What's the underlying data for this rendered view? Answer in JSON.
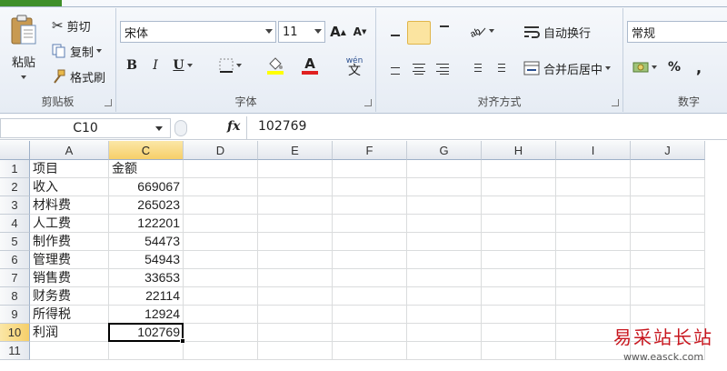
{
  "ribbon": {
    "clipboard": {
      "paste_label": "粘贴",
      "cut_label": "剪切",
      "copy_label": "复制",
      "format_painter_label": "格式刷",
      "group_label": "剪贴板"
    },
    "font": {
      "font_name": "宋体",
      "font_size": "11",
      "grow_label": "A",
      "shrink_label": "A",
      "bold_label": "B",
      "italic_label": "I",
      "underline_label": "U",
      "font_color_label": "A",
      "phonetic_label": "wén",
      "phonetic_char": "文",
      "group_label": "字体"
    },
    "alignment": {
      "wrap_text_label": "自动换行",
      "merge_center_label": "合并后居中",
      "group_label": "对齐方式"
    },
    "number": {
      "format_value": "常规",
      "percent_label": "%",
      "comma_label": ",",
      "group_label": "数字"
    }
  },
  "formula_bar": {
    "name_box": "C10",
    "fx_label": "fx",
    "value": "102769"
  },
  "sheet": {
    "columns": [
      "A",
      "C",
      "D",
      "E",
      "F",
      "G",
      "H",
      "I",
      "J"
    ],
    "selected_column": "C",
    "rows": [
      {
        "num": "1",
        "a": "项目",
        "c": "金额"
      },
      {
        "num": "2",
        "a": "收入",
        "c": "669067"
      },
      {
        "num": "3",
        "a": "材料费",
        "c": "265023"
      },
      {
        "num": "4",
        "a": "人工费",
        "c": "122201"
      },
      {
        "num": "5",
        "a": "制作费",
        "c": "54473"
      },
      {
        "num": "6",
        "a": "管理费",
        "c": "54943"
      },
      {
        "num": "7",
        "a": "销售费",
        "c": "33653"
      },
      {
        "num": "8",
        "a": "财务费",
        "c": "22114"
      },
      {
        "num": "9",
        "a": "所得税",
        "c": "12924"
      },
      {
        "num": "10",
        "a": "利润",
        "c": "102769"
      },
      {
        "num": "11",
        "a": "",
        "c": ""
      }
    ],
    "active_cell": "C10"
  },
  "watermark": {
    "title": "易采站长站",
    "url": "www.easck.com"
  }
}
